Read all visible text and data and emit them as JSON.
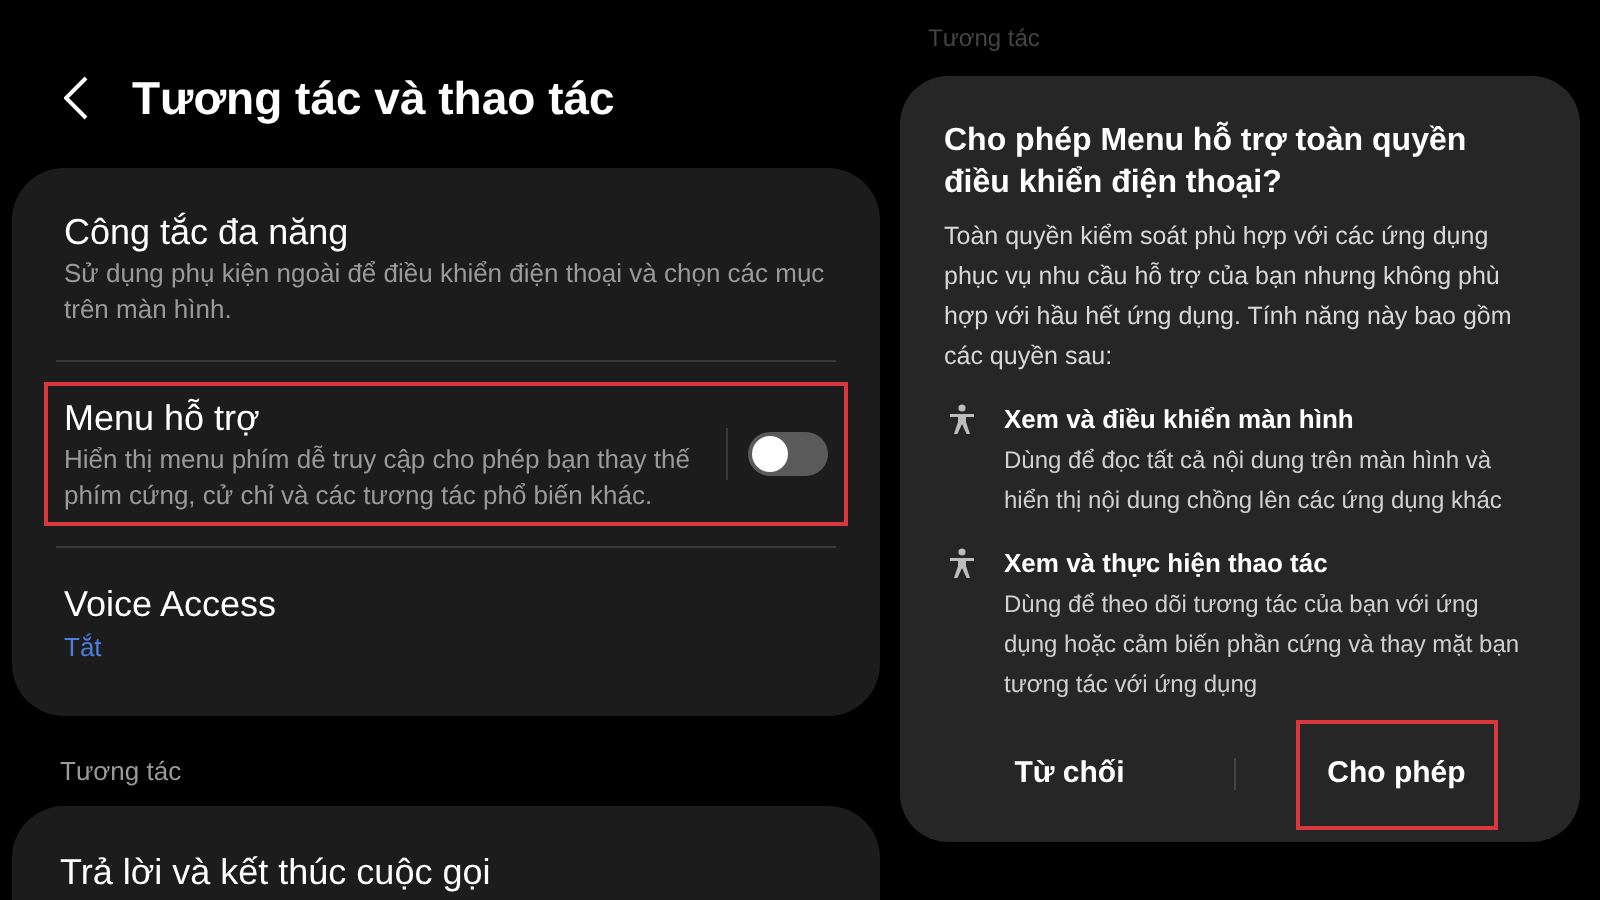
{
  "header": {
    "title": "Tương tác và thao tác"
  },
  "settings_card": [
    {
      "kind": "text",
      "title": "Công tắc đa năng",
      "subtitle": "Sử dụng phụ kiện ngoài để điều khiển điện thoại và chọn các mục trên màn hình.",
      "highlighted": false
    },
    {
      "kind": "toggle",
      "title": "Menu hỗ trợ",
      "subtitle": "Hiển thị menu phím dễ truy cập cho phép bạn thay thế phím cứng, cử chỉ và các tương tác phổ biến khác.",
      "on": false,
      "highlighted": true
    },
    {
      "kind": "status",
      "title": "Voice Access",
      "status": "Tắt",
      "highlighted": false
    }
  ],
  "section_header": "Tương tác",
  "second_card": [
    {
      "title": "Trả lời và kết thúc cuộc gọi"
    }
  ],
  "background_section_header": "Tương tác",
  "dialog": {
    "title": "Cho phép Menu hỗ trợ toàn quyền điều khiển điện thoại?",
    "body": "Toàn quyền kiểm soát phù hợp với các ứng dụng phục vụ nhu cầu hỗ trợ của bạn nhưng không phù hợp với hầu hết ứng dụng. Tính năng này bao gồm các quyền sau:",
    "permissions": [
      {
        "title": "Xem và điều khiển màn hình",
        "description": "Dùng để đọc tất cả nội dung trên màn hình và hiển thị nội dung chồng lên các ứng dụng khác"
      },
      {
        "title": "Xem và thực hiện thao tác",
        "description": "Dùng để theo dõi tương tác của bạn với ứng dụng hoặc cảm biến phần cứng và thay mặt bạn tương tác với ứng dụng"
      }
    ],
    "buttons": [
      {
        "label": "Từ chối",
        "highlighted": false
      },
      {
        "label": "Cho phép",
        "highlighted": true
      }
    ]
  }
}
